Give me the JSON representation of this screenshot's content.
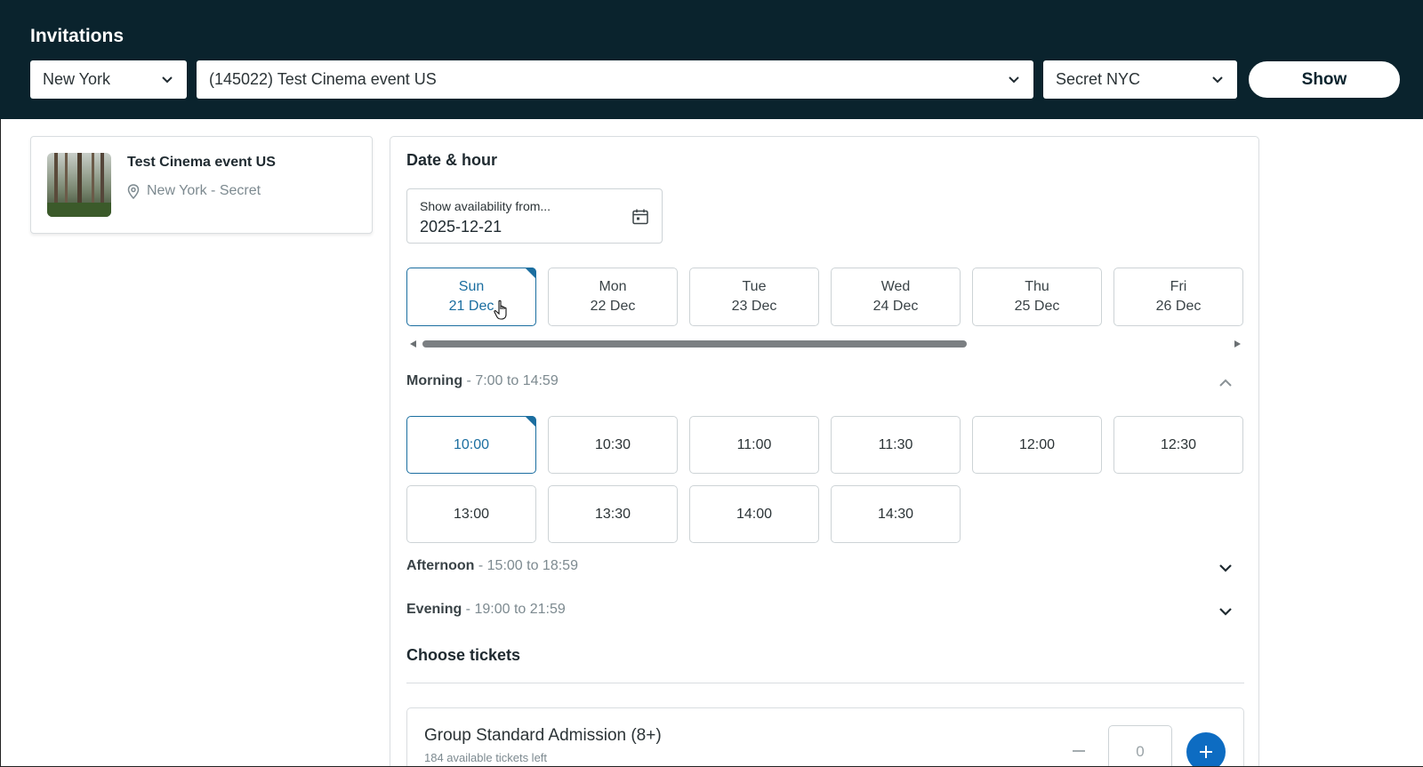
{
  "header": {
    "title": "Invitations",
    "city_select": "New York",
    "event_select": "(145022) Test Cinema event US",
    "venue_select": "Secret NYC",
    "show_button": "Show",
    "background": "#0a232d"
  },
  "event_card": {
    "title": "Test Cinema event US",
    "location": "New York - Secret",
    "thumbnail_icon": "forest-image"
  },
  "date_hour": {
    "heading": "Date & hour",
    "availability_label": "Show availability from...",
    "availability_value": "2025-12-21",
    "days": [
      {
        "weekday": "Sun",
        "date": "21 Dec",
        "selected": true
      },
      {
        "weekday": "Mon",
        "date": "22 Dec",
        "selected": false
      },
      {
        "weekday": "Tue",
        "date": "23 Dec",
        "selected": false
      },
      {
        "weekday": "Wed",
        "date": "24 Dec",
        "selected": false
      },
      {
        "weekday": "Thu",
        "date": "25 Dec",
        "selected": false
      },
      {
        "weekday": "Fri",
        "date": "26 Dec",
        "selected": false
      }
    ]
  },
  "periods": {
    "morning": {
      "name": "Morning",
      "range": " - 7:00 to 14:59",
      "expanded": true
    },
    "afternoon": {
      "name": "Afternoon",
      "range": " - 15:00 to 18:59",
      "expanded": false
    },
    "evening": {
      "name": "Evening",
      "range": " - 19:00 to 21:59",
      "expanded": false
    }
  },
  "morning_times": [
    "10:00",
    "10:30",
    "11:00",
    "11:30",
    "12:00",
    "12:30",
    "13:00",
    "13:30",
    "14:00",
    "14:30"
  ],
  "selected_time": "10:00",
  "tickets": {
    "heading": "Choose tickets",
    "items": [
      {
        "name": "Group Standard Admission (8+)",
        "availability": "184 available tickets left",
        "quantity": "0"
      }
    ]
  },
  "colors": {
    "accent": "#1b6ea0",
    "plus_button": "#0d6cc2"
  }
}
